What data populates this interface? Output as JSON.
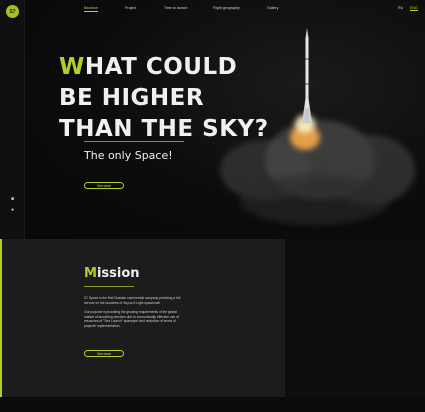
{
  "brand": {
    "logo_text": "S7"
  },
  "nav": {
    "items": [
      {
        "label": "Because"
      },
      {
        "label": "Project"
      },
      {
        "label": "Time to launch"
      },
      {
        "label": "Flight geography"
      },
      {
        "label": "Gallery"
      }
    ],
    "active_index": 0
  },
  "lang": {
    "ru": "RU",
    "eng": "ENG",
    "active": "ENG"
  },
  "social": [
    "facebook-icon",
    "vk-icon"
  ],
  "hero": {
    "headline_first_letter": "W",
    "headline_line1_rest": "HAT COULD",
    "headline_line2": "BE HIGHER",
    "headline_line3": "THAN THE SKY?",
    "subtitle": "The only Space!",
    "button_label": "See more"
  },
  "mission": {
    "title_first_letter": "M",
    "title_rest": "ission",
    "paragraph1": "S7 Space is the first Russian commercial company providing a full service on the launches of Soyuz-5 Light spacecraft.",
    "paragraph2": "Our purpose is providing the growing requirements of the global market of launching services due to economically effective use of resources of \"Sea Launch\" spaceport and reduction of terms of projects' implementation.",
    "button_label": "See more"
  },
  "colors": {
    "accent": "#b5cd2a",
    "background": "#0b0b0b",
    "panel": "#1c1c1c"
  }
}
